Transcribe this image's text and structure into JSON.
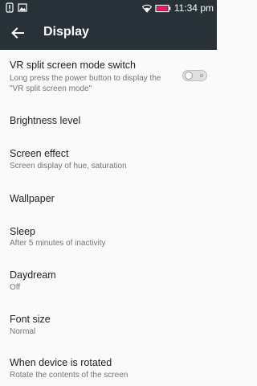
{
  "status_bar": {
    "time": "11:34 pm",
    "icons": [
      "notification-icon",
      "image-icon",
      "wifi-icon",
      "battery-icon"
    ]
  },
  "app_bar": {
    "title": "Display",
    "back_icon": "arrow-left-icon"
  },
  "settings": [
    {
      "title": "VR split screen mode switch",
      "subtitle_line1": "Long press the power button to display the",
      "subtitle_line2": "\"VR split screen mode\"",
      "toggle": {
        "on": false
      }
    },
    {
      "title": "Brightness level"
    },
    {
      "title": "Screen effect",
      "subtitle": "Screen display of hue, saturation"
    },
    {
      "title": "Wallpaper"
    },
    {
      "title": "Sleep",
      "subtitle": "After 5 minutes of inactivity"
    },
    {
      "title": "Daydream",
      "subtitle": "Off"
    },
    {
      "title": "Font size",
      "subtitle": "Normal"
    },
    {
      "title": "When device is rotated",
      "subtitle": "Rotate the contents of the screen"
    }
  ],
  "colors": {
    "toolbar_bg": "#263238",
    "page_bg": "#fafafa",
    "title_text": "#212121",
    "subtitle_text": "#757575"
  }
}
